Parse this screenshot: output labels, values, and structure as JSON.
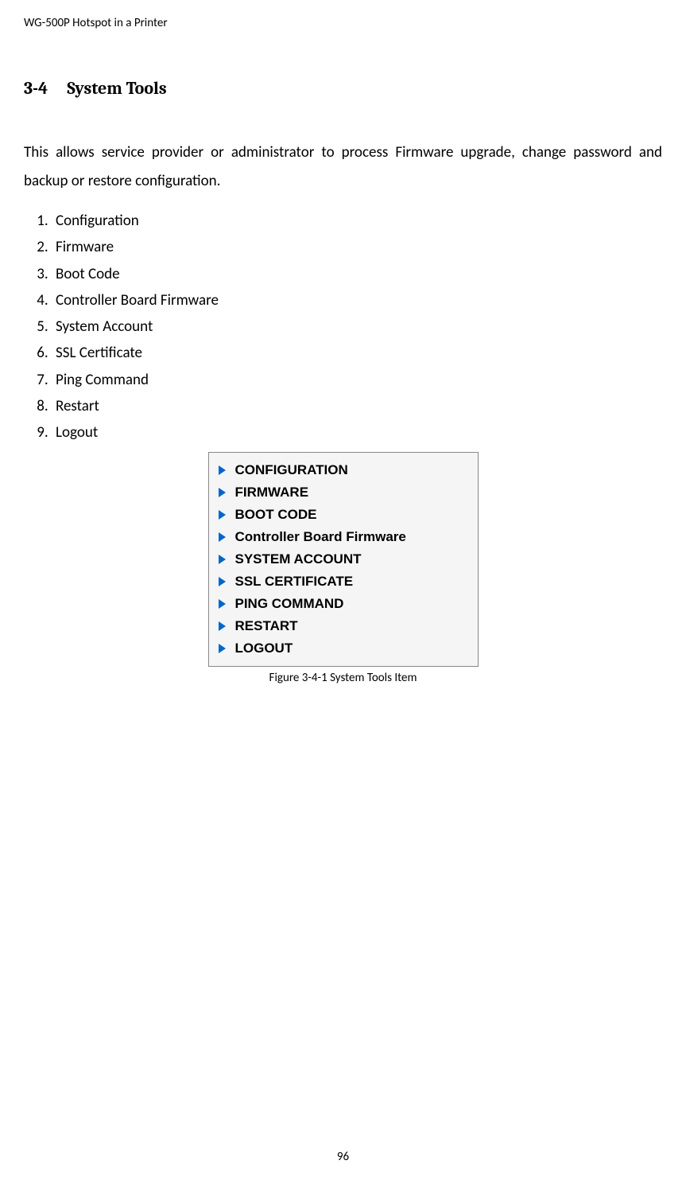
{
  "header": "WG-500P Hotspot in a Printer",
  "section": {
    "number": "3-4",
    "title": "System Tools"
  },
  "description": "This allows service provider or administrator to process Firmware upgrade, change password and backup or restore configuration.",
  "list": [
    "Configuration",
    "Firmware",
    "Boot Code",
    "Controller Board Firmware",
    "System Account",
    "SSL Certificate",
    "Ping Command",
    "Restart",
    "Logout"
  ],
  "menu_items": [
    "CONFIGURATION",
    "FIRMWARE",
    "BOOT CODE",
    "Controller Board Firmware",
    "SYSTEM ACCOUNT",
    "SSL CERTIFICATE",
    "PING COMMAND",
    "RESTART",
    "LOGOUT"
  ],
  "figure_caption": "Figure 3-4-1 System Tools Item",
  "page_number": "96"
}
